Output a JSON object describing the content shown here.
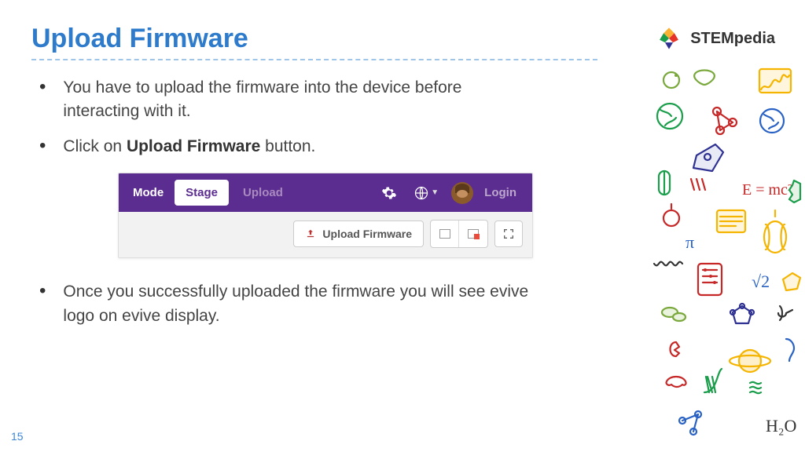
{
  "title": "Upload Firmware",
  "bullets": [
    {
      "pre": "You have to upload the firmware into the device before interacting with it."
    },
    {
      "pre": "Click on ",
      "bold": "Upload Firmware",
      "post": " button."
    },
    {
      "pre": "Once you successfully uploaded the firmware you will see evive logo on evive display."
    }
  ],
  "toolbar": {
    "mode_label": "Mode",
    "tab_stage": "Stage",
    "tab_upload": "Upload",
    "login_label": "Login"
  },
  "subbar": {
    "upload_firmware_label": "Upload Firmware"
  },
  "brand": "STEMpedia",
  "page_number": "15"
}
